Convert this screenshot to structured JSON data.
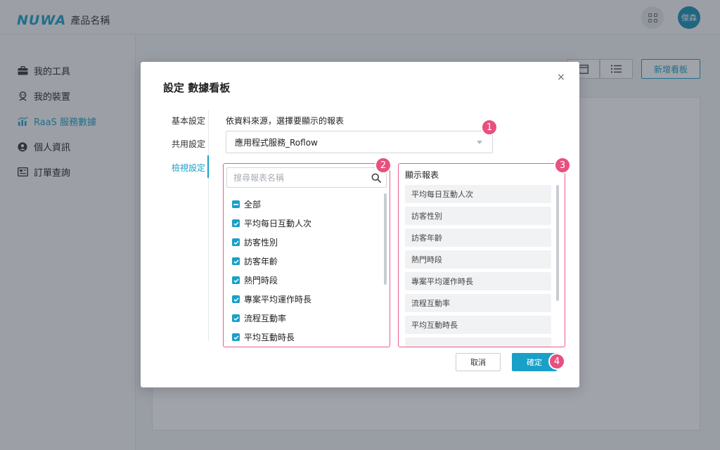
{
  "header": {
    "logo_mark": "NUWA",
    "product_name": "產品名稱",
    "avatar_text": "傑森"
  },
  "sidebar": {
    "items": [
      {
        "label": "我的工具",
        "icon": "toolbox-icon",
        "active": false
      },
      {
        "label": "我的裝置",
        "icon": "robot-icon",
        "active": false
      },
      {
        "label": "RaaS 服務數據",
        "icon": "chart-icon",
        "active": true
      },
      {
        "label": "個人資訊",
        "icon": "user-icon",
        "active": false
      },
      {
        "label": "訂單查詢",
        "icon": "receipt-icon",
        "active": false
      }
    ]
  },
  "main": {
    "add_board_label": "新增看板"
  },
  "modal": {
    "title": "設定 數據看板",
    "close_glyph": "×",
    "tabs": [
      {
        "label": "基本設定",
        "active": false
      },
      {
        "label": "共用設定",
        "active": false
      },
      {
        "label": "檢視設定",
        "active": true
      }
    ],
    "source_label": "依資料來源，選擇要顯示的報表",
    "source_value": "應用程式服務_Roflow",
    "search_placeholder": "搜尋報表名稱",
    "checklist": [
      {
        "label": "全部",
        "state": "indeterminate"
      },
      {
        "label": "平均每日互動人次",
        "state": "checked"
      },
      {
        "label": "訪客性別",
        "state": "checked"
      },
      {
        "label": "訪客年齡",
        "state": "checked"
      },
      {
        "label": "熱門時段",
        "state": "checked"
      },
      {
        "label": "專案平均運作時長",
        "state": "checked"
      },
      {
        "label": "流程互動率",
        "state": "checked"
      },
      {
        "label": "平均互動時長",
        "state": "checked"
      }
    ],
    "display_title": "顯示報表",
    "display_items": [
      "平均每日互動人次",
      "訪客性別",
      "訪客年齡",
      "熱門時段",
      "專案平均運作時長",
      "流程互動率",
      "平均互動時長"
    ],
    "cancel_label": "取消",
    "confirm_label": "確定"
  },
  "badges": [
    "1",
    "2",
    "3",
    "4"
  ],
  "colors": {
    "accent": "#19a0c9",
    "badge": "#e8507f",
    "avatar": "#1690b5"
  }
}
